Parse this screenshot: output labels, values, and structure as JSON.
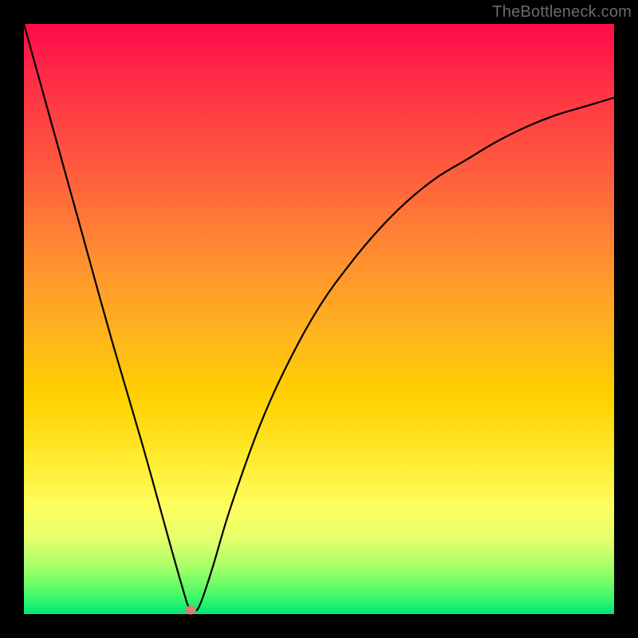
{
  "watermark": "TheBottleneck.com",
  "chart_data": {
    "type": "line",
    "title": "",
    "xlabel": "",
    "ylabel": "",
    "xlim": [
      0,
      100
    ],
    "ylim": [
      0,
      100
    ],
    "grid": false,
    "legend": false,
    "series": [
      {
        "name": "curve",
        "x": [
          0,
          5,
          10,
          15,
          20,
          25,
          27,
          28,
          29,
          30,
          32,
          35,
          40,
          45,
          50,
          55,
          60,
          65,
          70,
          75,
          80,
          85,
          90,
          95,
          100
        ],
        "values": [
          100,
          82,
          64,
          46,
          29,
          11,
          4,
          1,
          0.5,
          2,
          8,
          18,
          32,
          43,
          52,
          59,
          65,
          70,
          74,
          77,
          80,
          82.5,
          84.5,
          86,
          87.5
        ]
      }
    ],
    "annotations": [
      {
        "name": "marker-dot",
        "x": 28.3,
        "y": 0.7
      }
    ]
  },
  "colors": {
    "watermark": "#6a6a6a",
    "curve": "#000000",
    "marker": "#d77d7d"
  }
}
